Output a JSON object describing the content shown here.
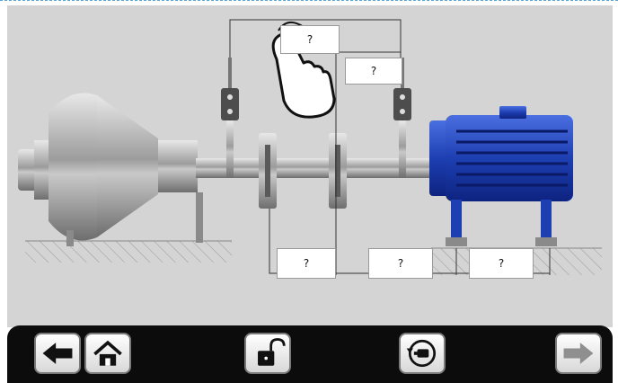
{
  "labels": {
    "top_upper": "?",
    "top_middle": "?",
    "bottom_left": "?",
    "bottom_middle": "?",
    "bottom_right": "?"
  },
  "toolbar": {
    "buttons": [
      "back-arrow-icon",
      "home-icon",
      "unlock-icon",
      "reset-rotate-icon",
      "forward-arrow-icon"
    ]
  },
  "colors": {
    "scene_bg": "#d4d4d4",
    "motor_blue": "#1d3fb2",
    "pump_gray": "#a9a9a9",
    "toolbar_bg": "#0c0c0c"
  }
}
